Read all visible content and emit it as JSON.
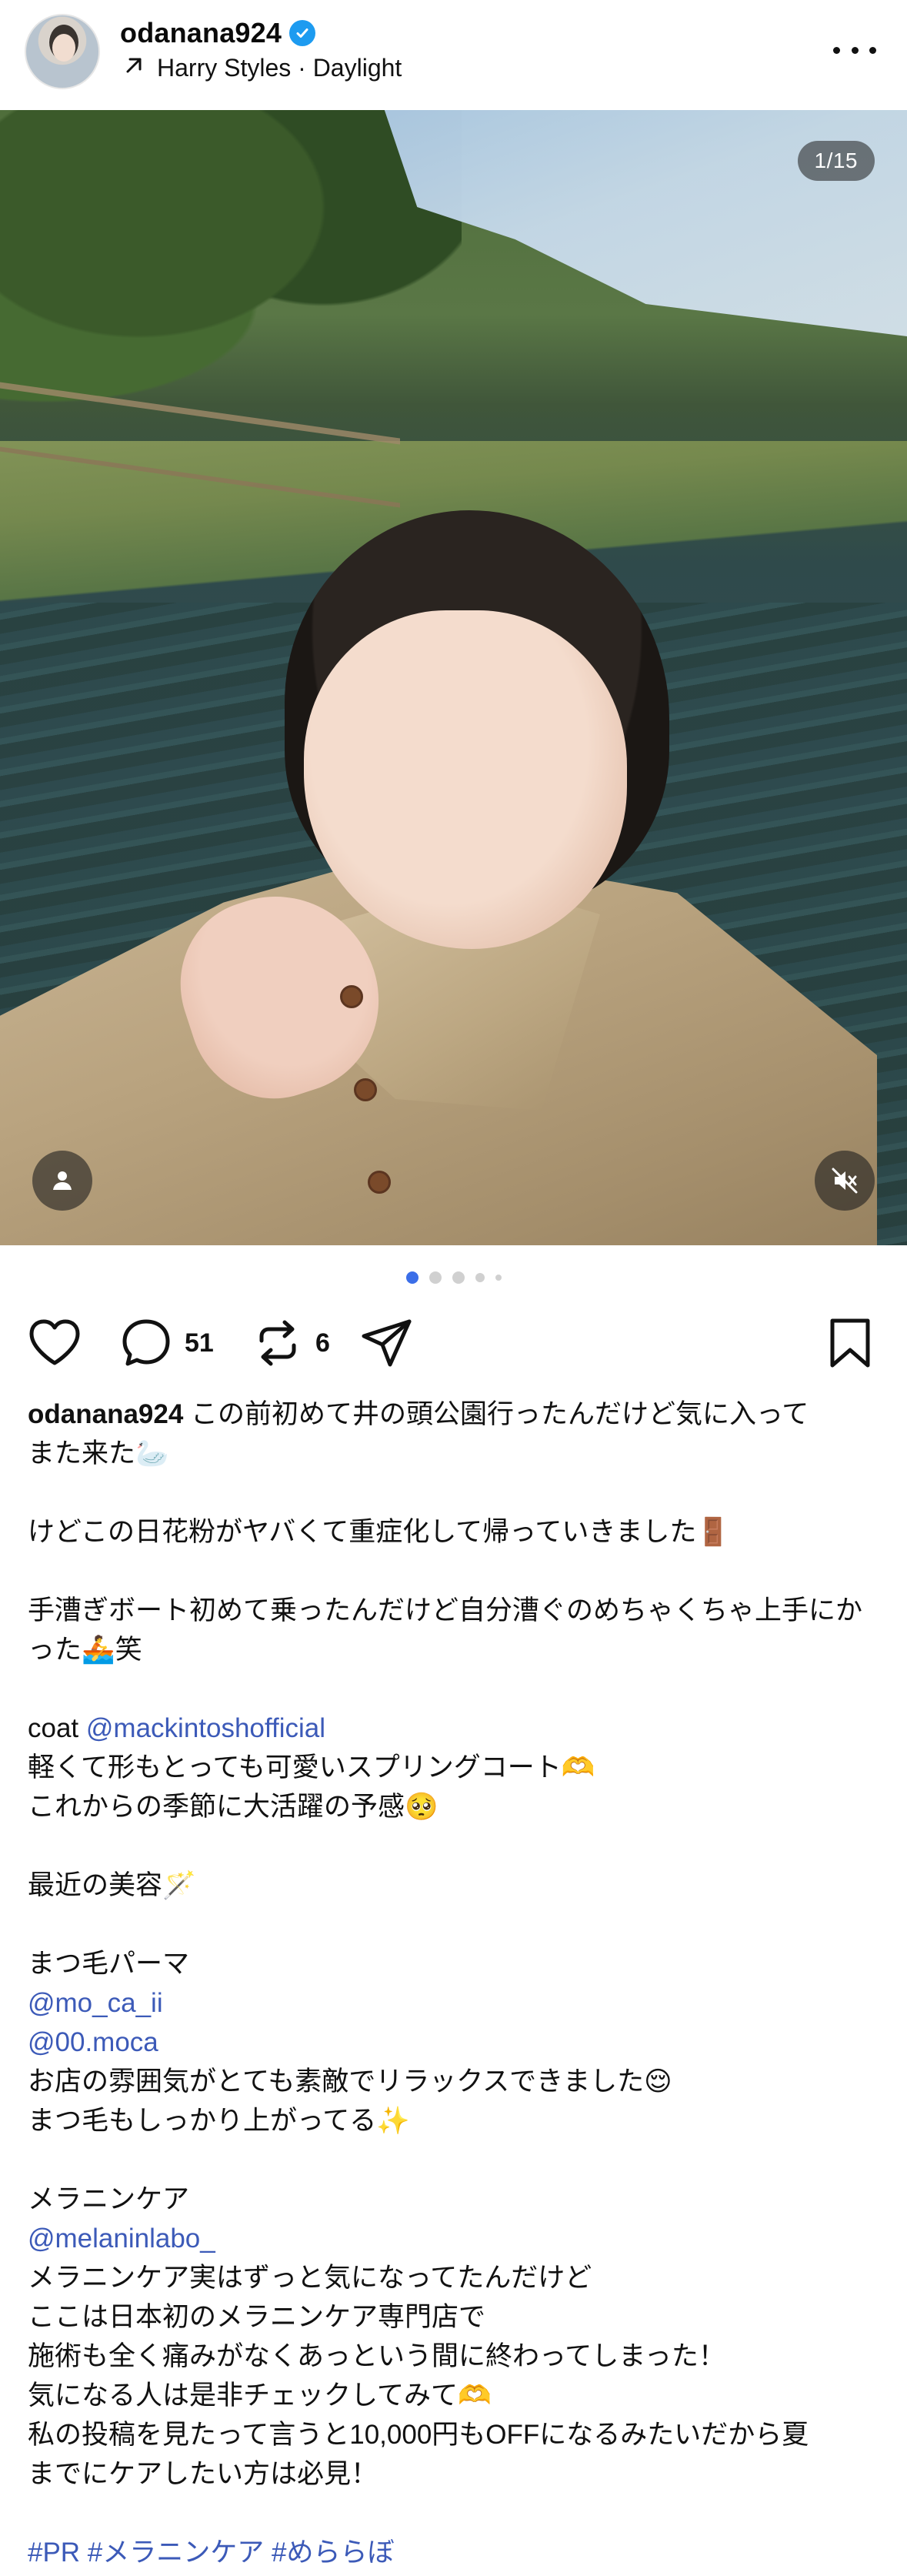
{
  "header": {
    "username": "odanana924",
    "music": "Harry Styles · Daylight",
    "avatar_icon": "profile-avatar",
    "verified_icon": "verified-badge-icon",
    "more_icon": "more-options-icon"
  },
  "photo": {
    "counter": "1/15",
    "tag_icon": "person-tag-icon",
    "mute_icon": "speaker-muted-icon"
  },
  "pagination": {
    "total_visible": 5,
    "active": 1
  },
  "actions": {
    "like_icon": "heart-icon",
    "comment_icon": "comment-bubble-icon",
    "comment_count": "51",
    "repost_icon": "repost-icon",
    "repost_count": "6",
    "share_icon": "paper-plane-icon",
    "save_icon": "bookmark-icon"
  },
  "caption": {
    "username": "odanana924",
    "lines": [
      {
        "text": "この前初めて井の頭公園行ったんだけど気に入って"
      },
      {
        "text": "また来た🦢"
      },
      {
        "text": ""
      },
      {
        "text": "けどこの日花粉がヤバくて重症化して帰っていきました🚪"
      },
      {
        "text": ""
      },
      {
        "text": "手漕ぎボート初めて乗ったんだけど自分漕ぐのめちゃくちゃ上手にか"
      },
      {
        "text": "った🚣笑"
      },
      {
        "text": ""
      },
      {
        "text": "coat ",
        "mention": "@mackintoshofficial"
      },
      {
        "text": "軽くて形もとっても可愛いスプリングコート🫶"
      },
      {
        "text": "これからの季節に大活躍の予感🥺"
      },
      {
        "text": ""
      },
      {
        "text": "最近の美容🪄"
      },
      {
        "text": ""
      },
      {
        "text": "まつ毛パーマ"
      },
      {
        "text": "",
        "mention": "@mo_ca_ii"
      },
      {
        "text": "",
        "mention": "@00.moca"
      },
      {
        "text": "お店の雰囲気がとても素敵でリラックスできました😌"
      },
      {
        "text": "まつ毛もしっかり上がってる✨"
      },
      {
        "text": ""
      },
      {
        "text": "メラニンケア"
      },
      {
        "text": "",
        "mention": "@melaninlabo_"
      },
      {
        "text": "メラニンケア実はずっと気になってたんだけど"
      },
      {
        "text": "ここは日本初のメラニンケア専門店で"
      },
      {
        "text": "施術も全く痛みがなくあっという間に終わってしまった！"
      },
      {
        "text": "気になる人は是非チェックしてみて🫶"
      },
      {
        "text": "私の投稿を見たって言うと10,000円もOFFになるみたいだから夏"
      },
      {
        "text": "までにケアしたい方は必見！"
      },
      {
        "text": ""
      },
      {
        "text": "",
        "mention": "#PR #メラニンケア #めららぼ"
      }
    ]
  }
}
